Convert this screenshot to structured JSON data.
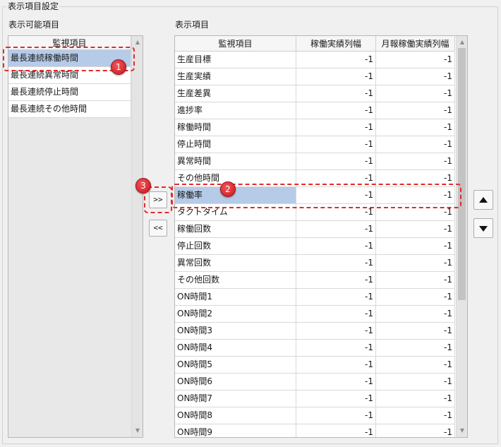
{
  "group_title": "表示項目設定",
  "available": {
    "label": "表示可能項目",
    "header": "監視項目",
    "items": [
      "最長連続稼働時間",
      "最長連続異常時間",
      "最長連続停止時間",
      "最長連続その他時間"
    ],
    "selected_index": 0
  },
  "display": {
    "label": "表示項目",
    "headers": [
      "監視項目",
      "稼働実績列幅",
      "月報稼働実績列幅"
    ],
    "rows": [
      [
        "生産目標",
        "-1",
        "-1"
      ],
      [
        "生産実績",
        "-1",
        "-1"
      ],
      [
        "生産差異",
        "-1",
        "-1"
      ],
      [
        "進捗率",
        "-1",
        "-1"
      ],
      [
        "稼働時間",
        "-1",
        "-1"
      ],
      [
        "停止時間",
        "-1",
        "-1"
      ],
      [
        "異常時間",
        "-1",
        "-1"
      ],
      [
        "その他時間",
        "-1",
        "-1"
      ],
      [
        "稼働率",
        "-1",
        "-1"
      ],
      [
        "タクトタイム",
        "-1",
        "-1"
      ],
      [
        "稼働回数",
        "-1",
        "-1"
      ],
      [
        "停止回数",
        "-1",
        "-1"
      ],
      [
        "異常回数",
        "-1",
        "-1"
      ],
      [
        "その他回数",
        "-1",
        "-1"
      ],
      [
        "ON時間1",
        "-1",
        "-1"
      ],
      [
        "ON時間2",
        "-1",
        "-1"
      ],
      [
        "ON時間3",
        "-1",
        "-1"
      ],
      [
        "ON時間4",
        "-1",
        "-1"
      ],
      [
        "ON時間5",
        "-1",
        "-1"
      ],
      [
        "ON時間6",
        "-1",
        "-1"
      ],
      [
        "ON時間7",
        "-1",
        "-1"
      ],
      [
        "ON時間8",
        "-1",
        "-1"
      ],
      [
        "ON時間9",
        "-1",
        "-1"
      ]
    ],
    "selected_index": 8
  },
  "buttons": {
    "add": ">>",
    "remove": "<<"
  },
  "badges": [
    "1",
    "2",
    "3"
  ],
  "icons": {
    "move_up": "triangle-up-icon",
    "move_down": "triangle-down-icon"
  },
  "colors": {
    "selection": "#b6cbe8",
    "annotation": "#e12b2b"
  }
}
